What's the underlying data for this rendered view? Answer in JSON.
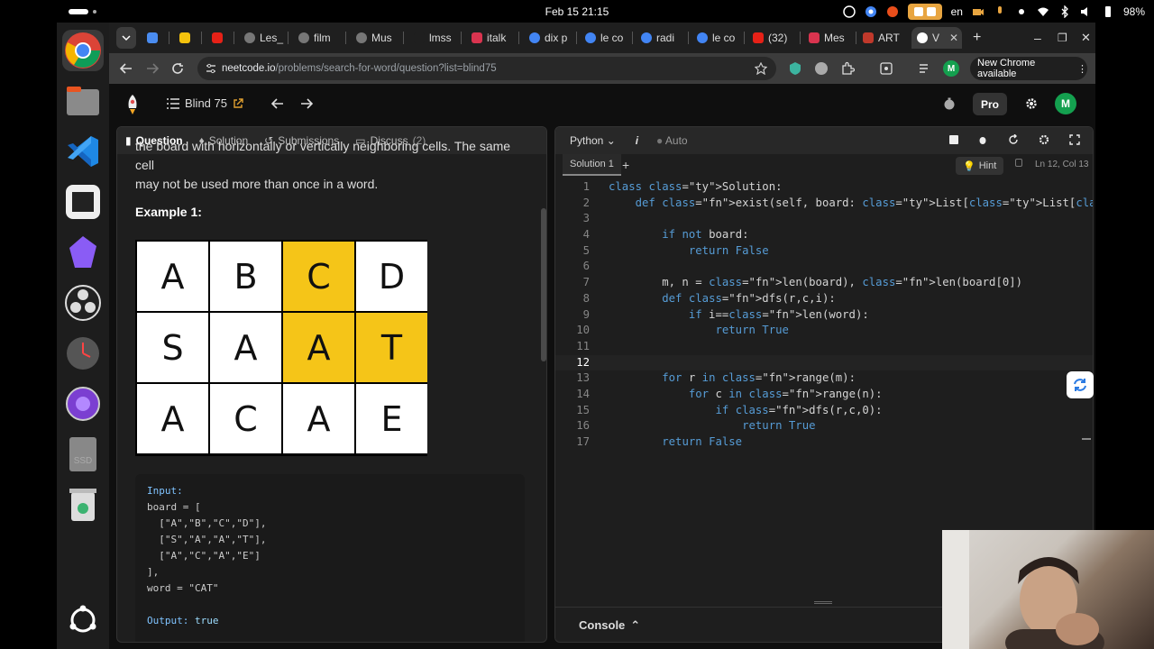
{
  "os": {
    "clock": "Feb 15  21:15",
    "lang": "en",
    "battery": "98%"
  },
  "dock": {
    "items": [
      "Google Chrome",
      "Files",
      "Visual Studio Code",
      "Terminal",
      "Obsidian",
      "OBS Studio",
      "Clock",
      "Screen Recorder",
      "Disk",
      "Trash",
      "Show Apps"
    ]
  },
  "browser": {
    "tabs": [
      {
        "label": ""
      },
      {
        "label": ""
      },
      {
        "label": ""
      },
      {
        "label": "Les_"
      },
      {
        "label": "film"
      },
      {
        "label": "Mus"
      },
      {
        "label": "lmss"
      },
      {
        "label": "italk"
      },
      {
        "label": "dix p"
      },
      {
        "label": "le co"
      },
      {
        "label": "radi"
      },
      {
        "label": "le co"
      },
      {
        "label": "(32)"
      },
      {
        "label": "Mes"
      },
      {
        "label": "ART"
      },
      {
        "label": "V"
      }
    ],
    "url_host": "neetcode.io",
    "url_path": "/problems/search-for-word/question?list=blind75",
    "new_chrome": "New Chrome available"
  },
  "header": {
    "list_name": "Blind 75",
    "pro": "Pro",
    "avatar": "M"
  },
  "left": {
    "tabs": [
      {
        "label": "Question"
      },
      {
        "label": "Solution"
      },
      {
        "label": "Submissions"
      },
      {
        "label": "Discuss"
      }
    ],
    "discuss_count": "(2)",
    "desc_line1": "the board with horizontally or vertically neighboring cells. The same cell",
    "desc_line2": "may not be used more than once in a word.",
    "example_title": "Example 1:",
    "grid": [
      [
        "A",
        "B",
        "C",
        "D"
      ],
      [
        "S",
        "A",
        "A",
        "T"
      ],
      [
        "A",
        "C",
        "A",
        "E"
      ]
    ],
    "highlight_color": "#f5c518",
    "io": {
      "input_label": "Input:",
      "board_open": "board = [",
      "row1": "  [\"A\",\"B\",\"C\",\"D\"],",
      "row2": "  [\"S\",\"A\",\"A\",\"T\"],",
      "row3": "  [\"A\",\"C\",\"A\",\"E\"]",
      "board_close": "],",
      "word_line": "word = \"CAT\"",
      "output_label": "Output:",
      "output_value": "true"
    }
  },
  "editor": {
    "language": "Python",
    "auto": "Auto",
    "solution_tab": "Solution 1",
    "hint": "Hint",
    "cursor": "Ln 12, Col 13",
    "console": "Console",
    "lines": [
      "class Solution:",
      "    def exist(self, board: List[List[str]], word: str) -> bool:",
      "",
      "        if not board:",
      "            return False",
      "",
      "        m, n = len(board), len(board[0])",
      "        def dfs(r,c,i):",
      "            if i==len(word):",
      "                return True",
      "",
      "",
      "        for r in range(m):",
      "            for c in range(n):",
      "                if dfs(r,c,0):",
      "                    return True",
      "        return False"
    ]
  }
}
